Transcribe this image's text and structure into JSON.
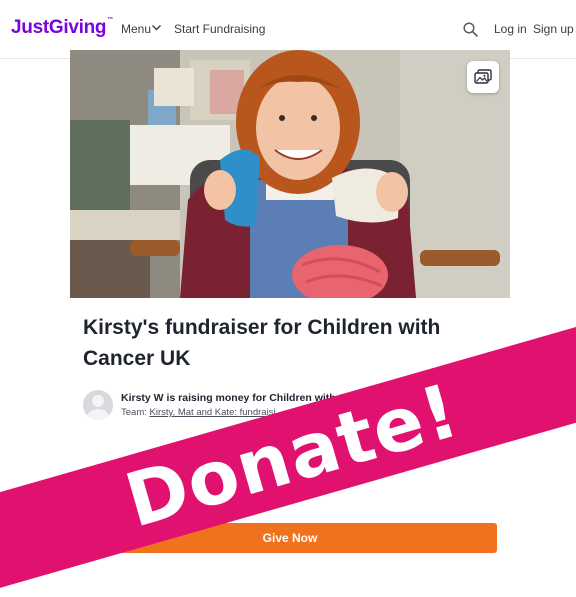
{
  "header": {
    "logo": "JustGiving",
    "menu_label": "Menu",
    "start_label": "Start Fundraising",
    "login_label": "Log in",
    "signup_label": "Sign up"
  },
  "hero": {
    "image_alt": "Girl smiling holding blue and white knitting with a ball of pink wool",
    "gallery_icon": "gallery-icon"
  },
  "page": {
    "title": "Kirsty's fundraiser for Children with Cancer UK",
    "organiser_text": "Kirsty W is raising money for Children with Can",
    "team_prefix": "Team:",
    "team_link": "Kirsty, Mat and Kate: fundraisi"
  },
  "banner": {
    "text": "Donate!"
  },
  "cta": {
    "give_now_label": "Give Now"
  },
  "colors": {
    "brand": "#7a04dd",
    "banner": "#e0116f",
    "cta": "#f0721e"
  }
}
